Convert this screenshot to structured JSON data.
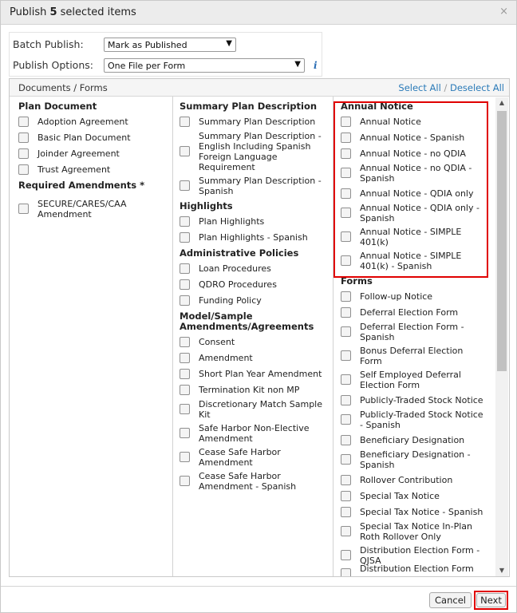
{
  "dialog": {
    "title_prefix": "Publish ",
    "title_count": "5",
    "title_suffix": " selected items",
    "close_symbol": "×"
  },
  "options": {
    "batch_label": "Batch Publish:",
    "batch_value": "Mark as Published",
    "publish_label": "Publish Options:",
    "publish_value": "One File per Form",
    "info_symbol": "i"
  },
  "panel": {
    "title": "Documents / Forms",
    "select_all": "Select All",
    "separator": " / ",
    "deselect_all": "Deselect All"
  },
  "columns": [
    {
      "groups": [
        {
          "heading": "Plan Document",
          "items": [
            "Adoption Agreement",
            "Basic Plan Document",
            "Joinder Agreement",
            "Trust Agreement"
          ]
        },
        {
          "heading": "Required Amendments *",
          "items": [
            "SECURE/CARES/CAA Amendment"
          ]
        }
      ]
    },
    {
      "groups": [
        {
          "heading": "Summary Plan Description",
          "items": [
            "Summary Plan Description",
            "Summary Plan Description - English Including Spanish Foreign Language Requirement",
            "Summary Plan Description - Spanish"
          ]
        },
        {
          "heading": "Highlights",
          "items": [
            "Plan Highlights",
            "Plan Highlights - Spanish"
          ]
        },
        {
          "heading": "Administrative Policies",
          "items": [
            "Loan Procedures",
            "QDRO Procedures",
            "Funding Policy"
          ]
        },
        {
          "heading": "Model/Sample Amendments/Agreements",
          "items": [
            "Consent",
            "Amendment",
            "Short Plan Year Amendment",
            "Termination Kit non MP",
            "Discretionary Match Sample Kit",
            "Safe Harbor Non-Elective Amendment",
            "Cease Safe Harbor Amendment",
            "Cease Safe Harbor Amendment - Spanish"
          ]
        }
      ]
    },
    {
      "groups": [
        {
          "heading": "Annual Notice",
          "items": [
            "Annual Notice",
            "Annual Notice - Spanish",
            "Annual Notice - no QDIA",
            "Annual Notice - no QDIA - Spanish",
            "Annual Notice - QDIA only",
            "Annual Notice - QDIA only - Spanish",
            "Annual Notice - SIMPLE 401(k)",
            "Annual Notice - SIMPLE 401(k) - Spanish"
          ]
        },
        {
          "heading": "Forms",
          "items": [
            "Follow-up Notice",
            "Deferral Election Form",
            "Deferral Election Form - Spanish",
            "Bonus Deferral Election Form",
            "Self Employed Deferral Election Form",
            "Publicly-Traded Stock Notice",
            "Publicly-Traded Stock Notice - Spanish",
            "Beneficiary Designation",
            "Beneficiary Designation - Spanish",
            "Rollover Contribution",
            "Special Tax Notice",
            "Special Tax Notice - Spanish",
            "Special Tax Notice In-Plan Roth Rollover Only",
            "Distribution Election Form - QJSA",
            "Distribution Election Form"
          ]
        }
      ]
    }
  ],
  "footer": {
    "cancel_label": "Cancel",
    "next_label": "Next"
  },
  "colors": {
    "link": "#2a7ab8",
    "highlight": "#e00000"
  }
}
